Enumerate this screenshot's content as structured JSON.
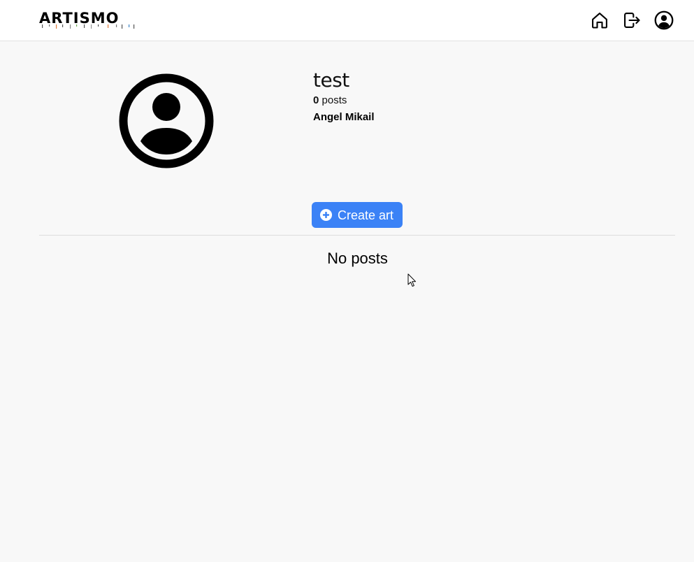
{
  "header": {
    "logo_text": "ARTISMO",
    "nav": [
      {
        "icon": "home-icon"
      },
      {
        "icon": "logout-icon"
      },
      {
        "icon": "user-circle-icon"
      }
    ]
  },
  "profile": {
    "avatar_icon": "user-circle-icon",
    "username": "test",
    "post_count": "0",
    "post_count_label": "posts",
    "full_name": "Angel Mikail"
  },
  "actions": {
    "create_label": "Create art",
    "create_icon": "plus-circle-icon"
  },
  "posts": {
    "empty_message": "No posts"
  },
  "colors": {
    "accent": "#3b82f6",
    "background": "#f8f8f8",
    "header_bg": "#ffffff"
  }
}
